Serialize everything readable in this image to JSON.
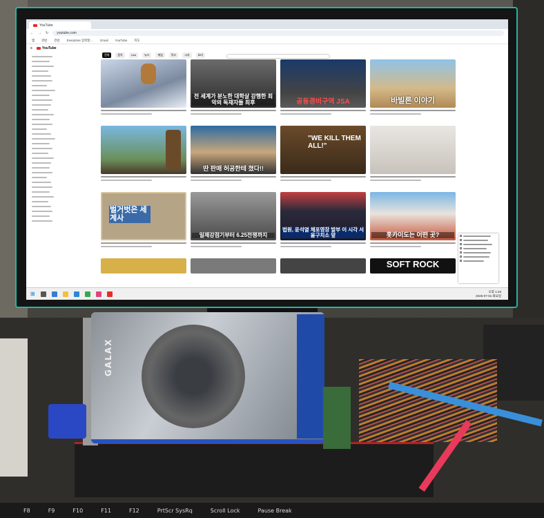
{
  "browser": {
    "tab_title": "YouTube",
    "url": "youtube.com",
    "bookmarks": [
      "앱",
      "관련",
      "관련",
      "Everytime 입력할…",
      "Gmail",
      "YouTube",
      "지도"
    ]
  },
  "youtube": {
    "logo_text": "YouTube",
    "chips": [
      "전체",
      "음악",
      "Live",
      "뉴스",
      "게임",
      "믹스",
      "시사",
      "요리"
    ],
    "videos": [
      {
        "caption": ""
      },
      {
        "caption": "전 세계가 분노한 대학살 강행한 최악의 독재자들 최후"
      },
      {
        "caption": "공동경비구역 JSA"
      },
      {
        "caption": "바빌론 이야기"
      },
      {
        "caption": ""
      },
      {
        "caption": "딴 판매 허공한테 쳤다!!"
      },
      {
        "caption": "\"WE KILL THEM ALL!\""
      },
      {
        "caption": ""
      },
      {
        "caption": "벌거벗은 세계사"
      },
      {
        "caption": "일제강점기부터 6.25전쟁까지"
      },
      {
        "caption": "법원, 윤석열 체포영장 발부 이 시각 서울구치소 앞"
      },
      {
        "caption": "홋카이도는 어떤 곳?"
      },
      {
        "caption": ""
      },
      {
        "caption": ""
      },
      {
        "caption": ""
      },
      {
        "caption": "SOFT ROCK"
      }
    ]
  },
  "taskbar": {
    "clock_time": "오후 1:33",
    "clock_date": "2025-07-01-화요일"
  },
  "gpu_brand": "GALAX",
  "keyboard_keys": [
    "F8",
    "F9",
    "F10",
    "F11",
    "F12",
    "PrtScr SysRq",
    "Scroll Lock",
    "Pause Break"
  ],
  "colors": {
    "bezel_accent": "#2bb3a0",
    "youtube_red": "#e52d27",
    "gpu_blue": "#2a52be"
  }
}
